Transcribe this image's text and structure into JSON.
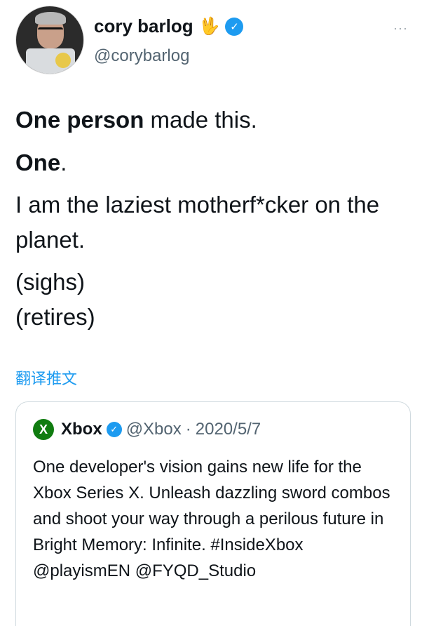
{
  "tweet": {
    "display_name": "cory barlog",
    "emoji": "🖖",
    "handle": "@corybarlog",
    "more_label": "···",
    "line1_bold": "One person",
    "line1_rest": " made this.",
    "line2_bold": "One",
    "line2_rest": ".",
    "line3": "I am the laziest motherf*cker on the planet.",
    "line4": "(sighs)",
    "line5": "(retires)",
    "translate_label": "翻译推文"
  },
  "quote": {
    "name": "Xbox",
    "handle": "@Xbox",
    "dot": "·",
    "date": "2020/5/7",
    "text": "One developer's vision gains new life for the Xbox Series X. Unleash dazzling sword combos and shoot your way through a perilous future in Bright Memory: Infinite. #InsideXbox @playismEN @FYQD_Studio"
  },
  "colors": {
    "link_blue": "#1d9bf0",
    "text_secondary": "#536471",
    "xbox_green": "#107c10"
  },
  "icons": [
    "avatar-image",
    "vulcan-salute-emoji",
    "verified-badge-icon",
    "more-options-icon",
    "xbox-logo-icon"
  ]
}
